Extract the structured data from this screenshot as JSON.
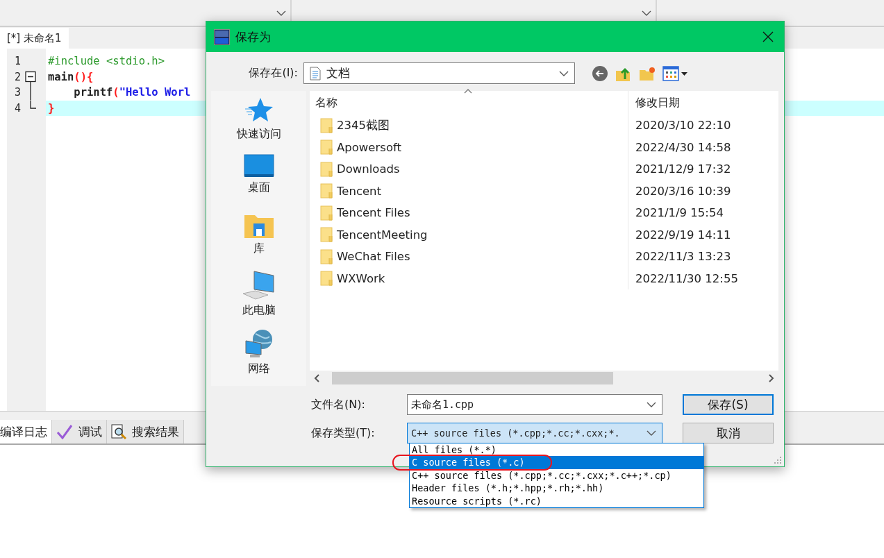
{
  "editor_tabs": [
    {
      "label": "[*] 未命名1",
      "selected": true
    }
  ],
  "code_lines": [
    {
      "number": "1",
      "kind": "plain",
      "current": false,
      "segments": [
        {
          "kind": "preprocessor",
          "text": "#include <stdio.h>"
        }
      ]
    },
    {
      "number": "2",
      "kind": "fold-start",
      "current": false,
      "segments": [
        {
          "kind": "plain",
          "text": "main"
        },
        {
          "kind": "symbol",
          "text": "(){"
        }
      ]
    },
    {
      "number": "3",
      "kind": "fold-body",
      "current": false,
      "segments": [
        {
          "kind": "plain",
          "text": "    printf"
        },
        {
          "kind": "symbol",
          "text": "("
        },
        {
          "kind": "string",
          "text": "\"Hello Worl"
        }
      ]
    },
    {
      "number": "4",
      "kind": "fold-end",
      "current": true,
      "segments": [
        {
          "kind": "symbol",
          "text": "}"
        }
      ]
    }
  ],
  "bottom_tabs": [
    {
      "label": "编译日志",
      "kind": "log",
      "selected": true
    },
    {
      "label": "调试",
      "kind": "debug",
      "selected": false
    },
    {
      "label": "搜索结果",
      "kind": "search",
      "selected": false
    }
  ],
  "dialog": {
    "title": "保存为",
    "location_label": "保存在(I):",
    "location": "文档",
    "places": [
      {
        "label": "快速访问",
        "kind": "quick-access"
      },
      {
        "label": "桌面",
        "kind": "desktop"
      },
      {
        "label": "库",
        "kind": "library"
      },
      {
        "label": "此电脑",
        "kind": "computer"
      },
      {
        "label": "网络",
        "kind": "network"
      }
    ],
    "columns": [
      "名称",
      "修改日期"
    ],
    "files": [
      {
        "name": "2345截图",
        "modified": "2020/3/10 22:10"
      },
      {
        "name": "Apowersoft",
        "modified": "2022/4/30 14:58"
      },
      {
        "name": "Downloads",
        "modified": "2021/12/9 17:32"
      },
      {
        "name": "Tencent",
        "modified": "2020/3/16 10:39"
      },
      {
        "name": "Tencent Files",
        "modified": "2021/1/9 15:54"
      },
      {
        "name": "TencentMeeting",
        "modified": "2022/9/19 14:11"
      },
      {
        "name": "WeChat Files",
        "modified": "2022/11/3 13:23"
      },
      {
        "name": "WXWork",
        "modified": "2022/11/30 12:55"
      }
    ],
    "filename_label": "文件名(N):",
    "filename": "未命名1.cpp",
    "type_label": "保存类型(T):",
    "type_value": "C++ source files (*.cpp;*.cc;*.cxx;*.",
    "type_options": [
      {
        "label": "All files (*.*)",
        "selected": false
      },
      {
        "label": "C source files (*.c)",
        "selected": true
      },
      {
        "label": "C++ source files (*.cpp;*.cc;*.cxx;*.c++;*.cp)",
        "selected": false
      },
      {
        "label": "Header files (*.h;*.hpp;*.rh;*.hh)",
        "selected": false
      },
      {
        "label": "Resource scripts (*.rc)",
        "selected": false
      }
    ],
    "buttons": [
      {
        "label": "保存(S)",
        "default": true
      },
      {
        "label": "取消",
        "default": false
      }
    ]
  }
}
